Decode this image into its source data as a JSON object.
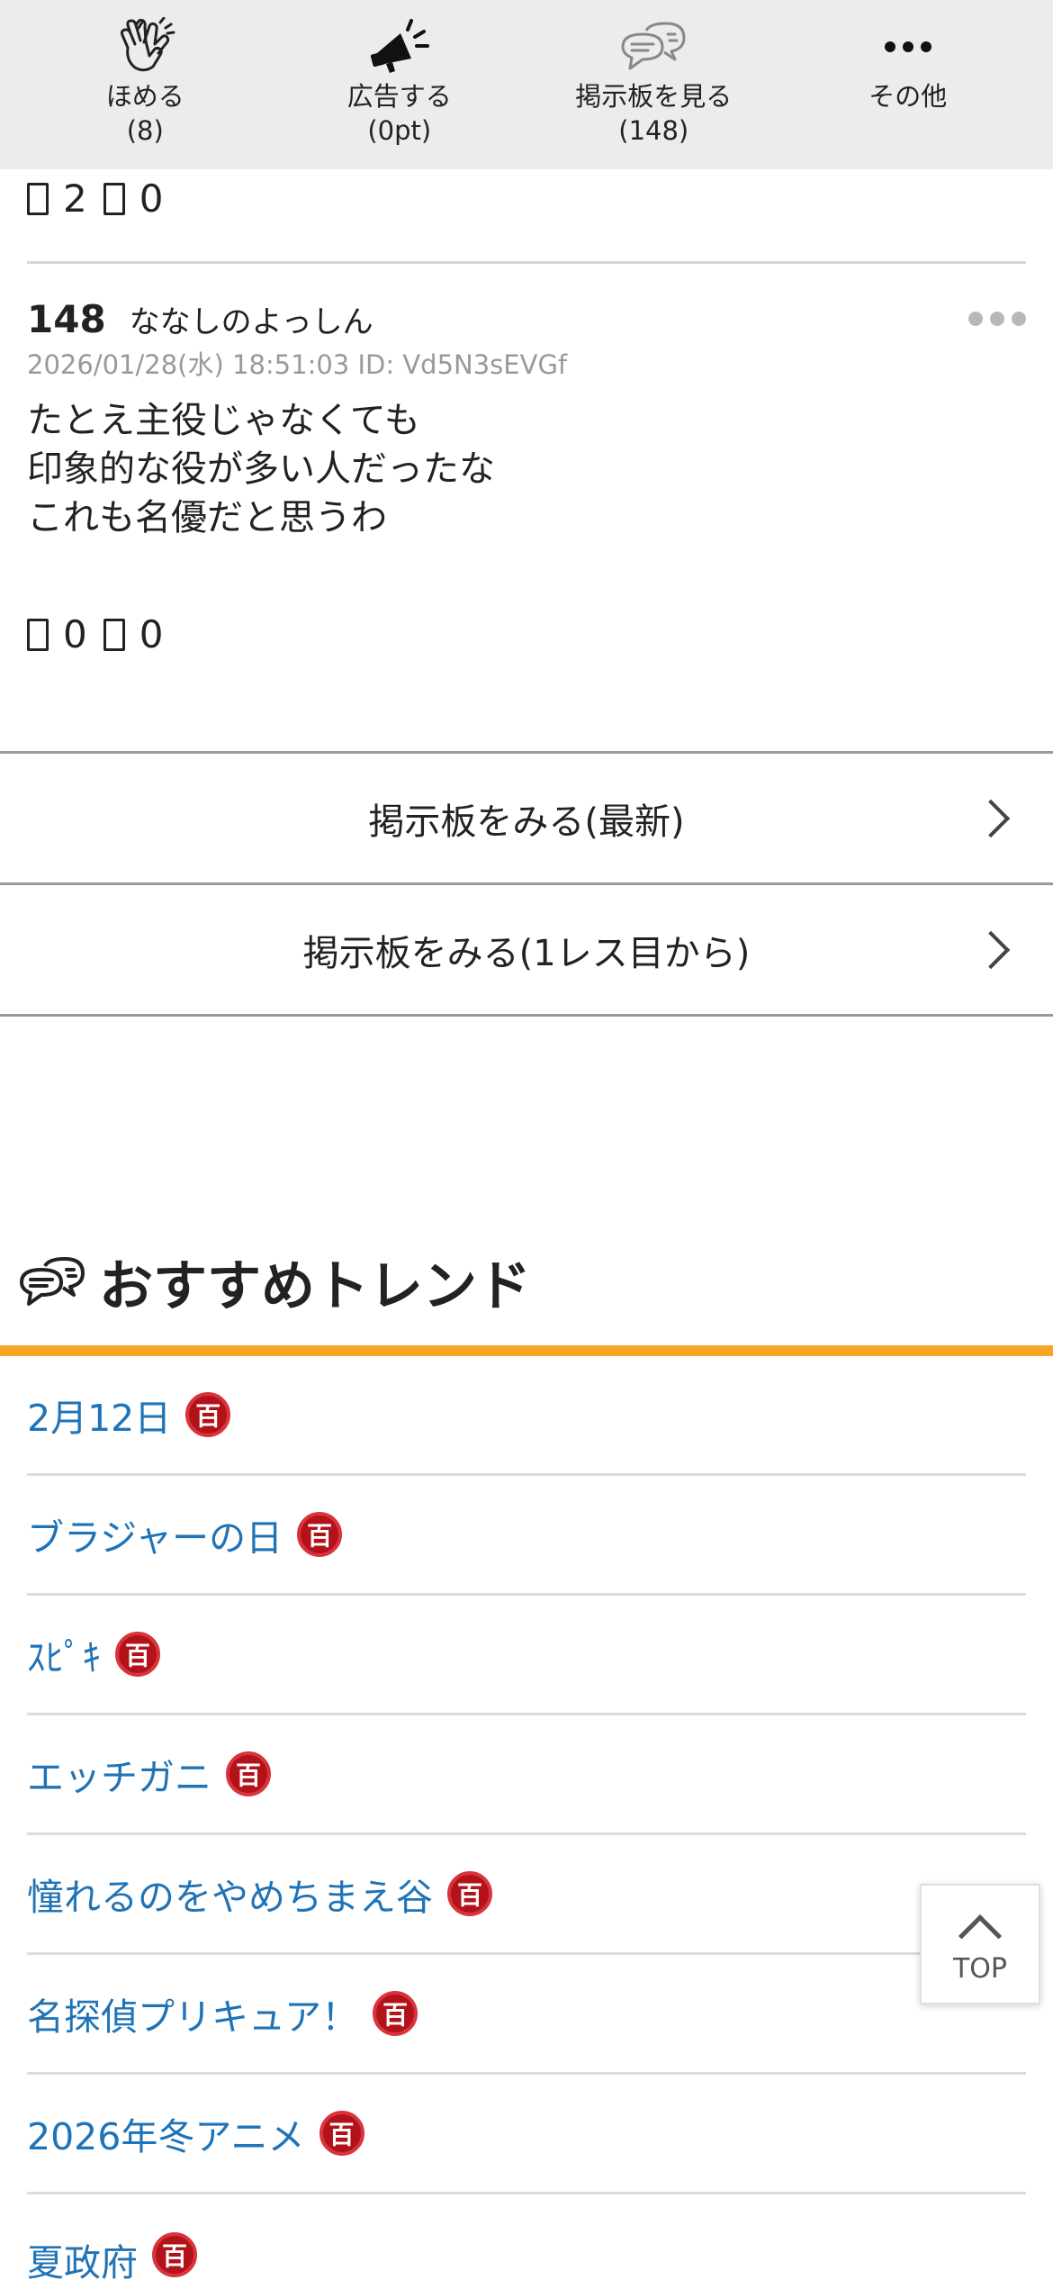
{
  "action_bar": {
    "items": [
      {
        "label": "ほめる",
        "count": "(8)",
        "icon": "clapping-hands-icon"
      },
      {
        "label": "広告する",
        "count": "(0pt)",
        "icon": "megaphone-icon"
      },
      {
        "label": "掲示板を見る",
        "count": "(148)",
        "icon": "speech-bubbles-icon"
      },
      {
        "label": "その他",
        "count": "",
        "icon": "more-dots-icon"
      }
    ]
  },
  "prev_post": {
    "likes": "2",
    "dislikes": "0"
  },
  "post": {
    "number": "148",
    "name": "ななしのよっしん",
    "meta": "2026/01/28(水) 18:51:03 ID: Vd5N3sEVGf",
    "lines": [
      "たとえ主役じゃなくても",
      "印象的な役が多い人だったな",
      "これも名優だと思うわ"
    ],
    "likes": "0",
    "dislikes": "0"
  },
  "board_buttons": {
    "latest": "掲示板をみる(最新)",
    "from_first": "掲示板をみる(1レス目から)"
  },
  "trends": {
    "title": "おすすめトレンド",
    "badge": "百",
    "items": [
      "2月12日",
      "ブラジャーの日",
      "ｽﾋﾟｷ",
      "エッチガニ",
      "憧れるのをやめちまえ谷",
      "名探偵プリキュア！",
      "2026年冬アニメ",
      "夏政府"
    ]
  },
  "top_button": {
    "label": "TOP"
  },
  "colors": {
    "accent_bar": "#f5a623",
    "link": "#1f73b7",
    "badge": "#b3121b",
    "action_bar_bg": "#ececec"
  }
}
